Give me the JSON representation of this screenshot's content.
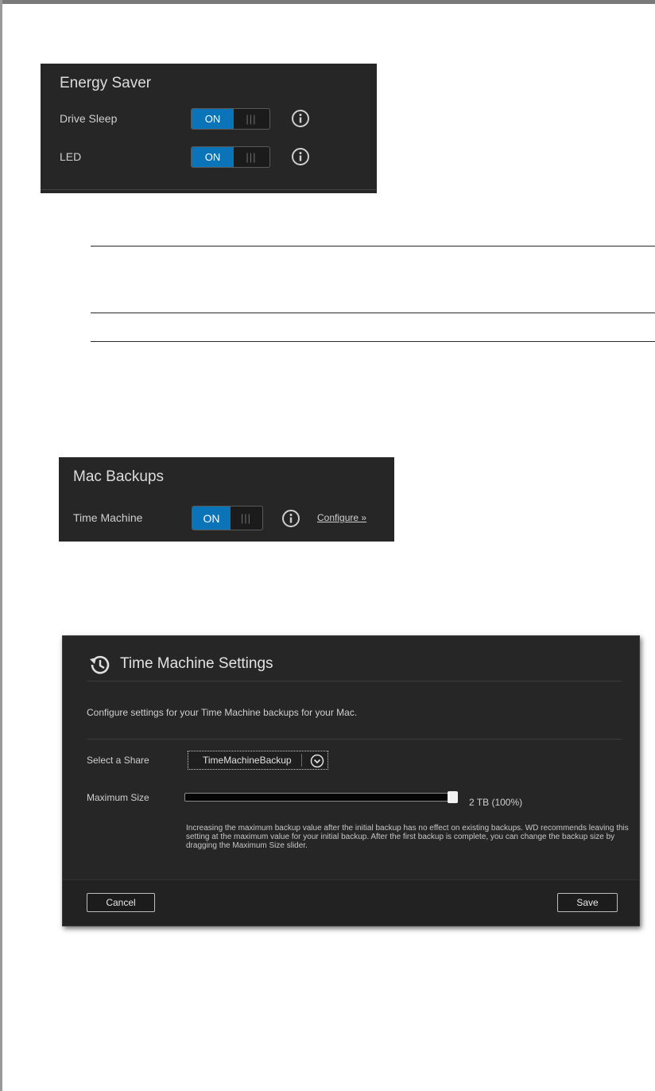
{
  "energy_saver": {
    "title": "Energy Saver",
    "settings": [
      {
        "label": "Drive Sleep",
        "toggle": "ON",
        "grip": "|||"
      },
      {
        "label": "LED",
        "toggle": "ON",
        "grip": "|||"
      }
    ]
  },
  "mac_backups": {
    "title": "Mac Backups",
    "setting": {
      "label": "Time Machine",
      "toggle": "ON",
      "grip": "|||",
      "link": "Configure »"
    }
  },
  "time_machine_dialog": {
    "title": "Time Machine Settings",
    "description": "Configure settings for your Time Machine backups for your Mac.",
    "share_label": "Select a Share",
    "share_value": "TimeMachineBackup",
    "max_size_label": "Maximum Size",
    "max_size_value": "2 TB (100%)",
    "slider_fraction": 1.0,
    "note": "Increasing the maximum backup value after the initial backup has no effect on existing backups. WD recommends leaving this setting at the maximum value for your initial backup. After the first backup is complete, you can change the backup size by dragging the Maximum Size slider.",
    "cancel_label": "Cancel",
    "save_label": "Save"
  },
  "colors": {
    "toggle_on": "#0b73b8",
    "panel_bg": "#262626"
  }
}
